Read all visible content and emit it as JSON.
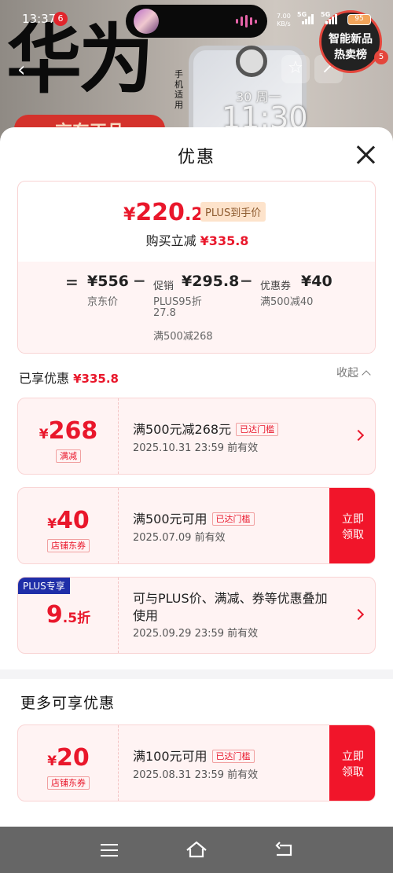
{
  "status_bar": {
    "time": "13:37",
    "notif_badge": "6",
    "net_speed": "7.00\nKB/s",
    "sig1": "5G",
    "sig2": "5G",
    "battery": "95"
  },
  "background": {
    "brand": "华为",
    "brand_suffix": "手机适用",
    "flag_text": "京东正品",
    "watch_date": "30 周一",
    "watch_time": "11:30",
    "hot_badge": "智能新品\n热卖榜",
    "hot_count": "5"
  },
  "sheet": {
    "title": "优惠",
    "summary": {
      "currency": "¥",
      "final_price_int": "220",
      "final_price_dec": ".2",
      "plus_tag": "PLUS到手价",
      "buy_reduce_label": "购买立减",
      "buy_reduce_value": "¥335.8",
      "eq": "=",
      "minus": "−",
      "jd_price": "¥556",
      "jd_price_label": "京东价",
      "promo_label": "促销",
      "promo_value": "¥295.8",
      "promo_detail_1": "PLUS95折",
      "promo_detail_2": "27.8",
      "promo_detail_3": "满500减268",
      "coupon_label": "优惠券",
      "coupon_value": "¥40",
      "coupon_detail": "满500减40"
    },
    "enjoyed_label": "已享优惠",
    "enjoyed_value": "¥335.8",
    "collapse_label": "收起",
    "coupons": [
      {
        "cur": "¥",
        "amount": "268",
        "type": "满减",
        "title": "满500元减268元",
        "reached": "已达门槛",
        "date": "2025.10.31 23:59 前有效"
      },
      {
        "cur": "¥",
        "amount": "40",
        "type": "店铺东券",
        "title": "满500元可用",
        "reached": "已达门槛",
        "date": "2025.07.09 前有效",
        "action": "立即\n领取"
      },
      {
        "ribbon": "PLUS专享",
        "amount": "9",
        "amount_dec": ".5折",
        "title": "可与PLUS价、满减、券等优惠叠加使用",
        "date": "2025.09.29 23:59 前有效"
      }
    ],
    "more_title": "更多可享优惠",
    "more_coupons": [
      {
        "cur": "¥",
        "amount": "20",
        "type": "店铺东券",
        "title": "满100元可用",
        "reached": "已达门槛",
        "date": "2025.08.31 23:59 前有效",
        "action": "立即\n领取"
      }
    ]
  }
}
